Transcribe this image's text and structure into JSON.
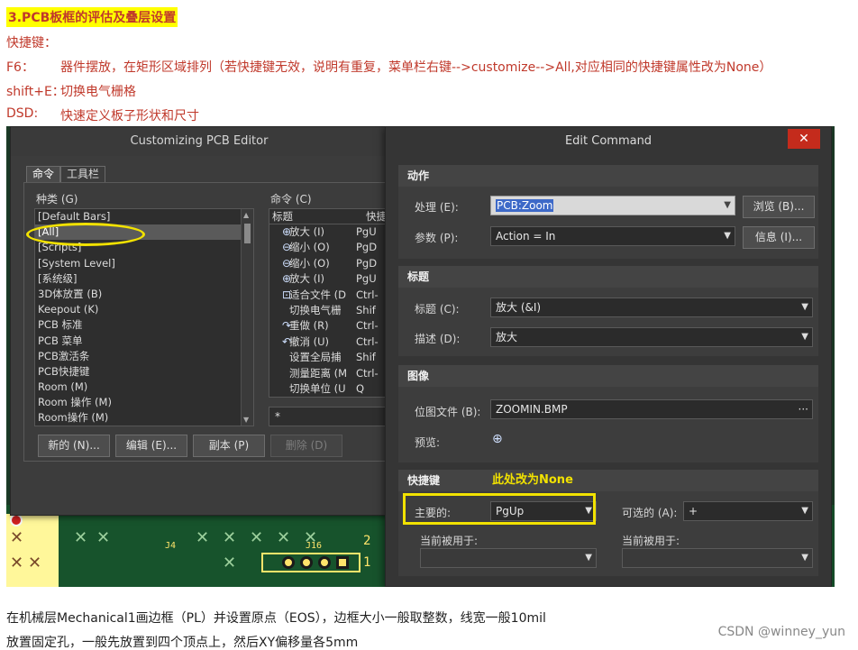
{
  "doc": {
    "heading": "3.PCB板框的评估及叠层设置",
    "shortcuts_title": "快捷键：",
    "lines": [
      {
        "key": "F6：",
        "text": "器件摆放，在矩形区域排列（若快捷键无效，说明有重复，菜单栏右键-->customize-->All,对应相同的快捷键属性改为None）"
      },
      {
        "key": "shift+E：",
        "text": "切换电气栅格"
      },
      {
        "key": "DSD:",
        "text": "快速定义板子形状和尺寸"
      }
    ],
    "footer": [
      "在机械层Mechanical1画边框（PL）并设置原点（EOS），边框大小一般取整数，线宽一般10mil",
      "放置固定孔，一般先放置到四个顶点上，然后XY偏移量各5mm"
    ],
    "watermark": "CSDN @winney_yun"
  },
  "pcb": {
    "labels": [
      "J4",
      "J16",
      "2",
      "1"
    ]
  },
  "customize_dialog": {
    "title": "Customizing PCB Editor",
    "tabs": [
      "命令",
      "工具栏"
    ],
    "categories_label": "种类 (G)",
    "categories": [
      "[Default Bars]",
      "[All]",
      "[Scripts]",
      "[System Level]",
      "[系统级]",
      "3D体放置 (B)",
      "Keepout (K)",
      "PCB 标准",
      "PCB 菜单",
      "PCB激活条",
      "PCB快捷键",
      "Room (M)",
      "Room 操作 (M)",
      "Room操作 (M)"
    ],
    "selected_category": "[All]",
    "commands_label": "命令 (C)",
    "command_columns": [
      "标题",
      "快捷"
    ],
    "commands": [
      {
        "icon": "zoom-in-icon",
        "glyph": "⊕",
        "title": "放大 (I)",
        "key": "PgU"
      },
      {
        "icon": "zoom-out-icon",
        "glyph": "⊖",
        "title": "缩小 (O)",
        "key": "PgD"
      },
      {
        "icon": "zoom-out-icon",
        "glyph": "⊖",
        "title": "缩小 (O)",
        "key": "PgD"
      },
      {
        "icon": "zoom-in-icon",
        "glyph": "⊕",
        "title": "放大 (I)",
        "key": "PgU"
      },
      {
        "icon": "fit-document-icon",
        "glyph": "⊡",
        "title": "适合文件 (D",
        "key": "Ctrl-"
      },
      {
        "icon": "",
        "glyph": "",
        "title": "切换电气栅",
        "key": "Shif"
      },
      {
        "icon": "redo-icon",
        "glyph": "↷",
        "title": "重做 (R)",
        "key": "Ctrl-"
      },
      {
        "icon": "undo-icon",
        "glyph": "↶",
        "title": "撤消 (U)",
        "key": "Ctrl-"
      },
      {
        "icon": "",
        "glyph": "",
        "title": "设置全局捕",
        "key": "Shif"
      },
      {
        "icon": "",
        "glyph": "",
        "title": "测量距离 (M",
        "key": "Ctrl-"
      },
      {
        "icon": "",
        "glyph": "",
        "title": "切换单位 (U",
        "key": "Q"
      }
    ],
    "search_value": "*",
    "buttons": {
      "new": "新的 (N)...",
      "edit": "编辑 (E)...",
      "copy": "副本 (P)",
      "delete": "删除 (D)"
    }
  },
  "edit_command": {
    "title": "Edit Command",
    "close": "✕",
    "action_section": "动作",
    "process_label": "处理 (E):",
    "process_value": "PCB:Zoom",
    "browse_button": "浏览 (B)...",
    "params_label": "参数 (P):",
    "params_value": "Action = In",
    "info_button": "信息 (I)...",
    "title_section": "标题",
    "caption_label": "标题 (C):",
    "caption_value": "放大 (&I)",
    "desc_label": "描述 (D):",
    "desc_value": "放大",
    "image_section": "图像",
    "bitmap_label": "位图文件 (B):",
    "bitmap_value": "ZOOMIN.BMP",
    "bitmap_more": "···",
    "preview_label": "预览:",
    "shortcut_section": "快捷键",
    "primary_label": "主要的:",
    "primary_value": "PgUp",
    "optional_label": "可选的 (A):",
    "optional_value": "+",
    "used_by_label": "当前被用于:",
    "used_by_label2": "当前被用于:",
    "annotation": "此处改为None"
  }
}
